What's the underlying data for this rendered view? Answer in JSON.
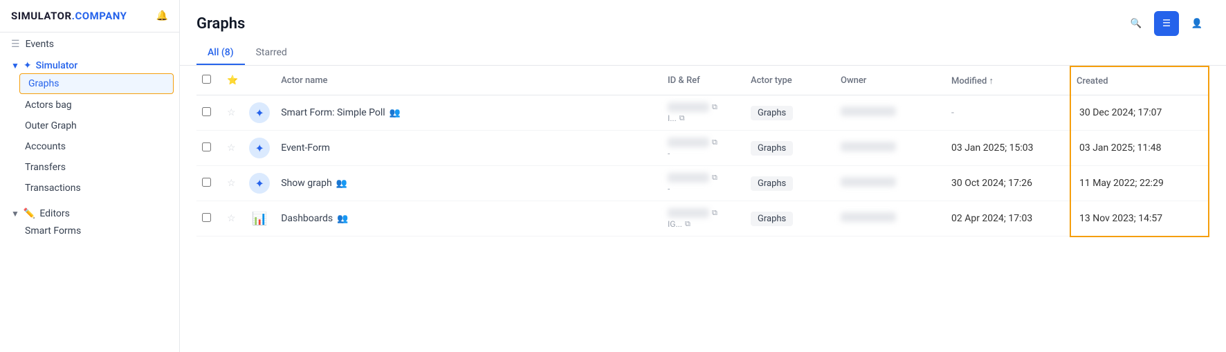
{
  "logo": {
    "prefix": "SIMULATOR",
    "suffix": ".COMPANY"
  },
  "sidebar": {
    "events_label": "Events",
    "simulator_label": "Simulator",
    "graphs_label": "Graphs",
    "actors_bag_label": "Actors bag",
    "outer_graph_label": "Outer Graph",
    "accounts_label": "Accounts",
    "transfers_label": "Transfers",
    "transactions_label": "Transactions",
    "editors_label": "Editors",
    "smart_forms_label": "Smart Forms"
  },
  "page": {
    "title": "Graphs"
  },
  "tabs": [
    {
      "label": "All (8)",
      "active": true
    },
    {
      "label": "Starred",
      "active": false
    }
  ],
  "table": {
    "columns": [
      {
        "label": ""
      },
      {
        "label": ""
      },
      {
        "label": ""
      },
      {
        "label": "Actor name"
      },
      {
        "label": "ID & Ref"
      },
      {
        "label": "Actor type"
      },
      {
        "label": "Owner"
      },
      {
        "label": "Modified ↑"
      },
      {
        "label": "Created"
      }
    ],
    "rows": [
      {
        "name": "Smart Form: Simple Poll",
        "has_people": true,
        "icon_type": "blue-actor",
        "id_blurred": true,
        "id_suffix": "I...",
        "actor_type": "Graphs",
        "owner_blurred": true,
        "modified": "-",
        "created": "30 Dec 2024; 17:07"
      },
      {
        "name": "Event-Form",
        "has_people": false,
        "icon_type": "blue-actor",
        "id_blurred": true,
        "id_suffix": "-",
        "actor_type": "Graphs",
        "owner_blurred": true,
        "modified": "03 Jan 2025; 15:03",
        "created": "03 Jan 2025; 11:48"
      },
      {
        "name": "Show graph",
        "has_people": true,
        "icon_type": "blue-actor",
        "id_blurred": true,
        "id_suffix": "-",
        "actor_type": "Graphs",
        "owner_blurred": true,
        "modified": "30 Oct 2024; 17:26",
        "created": "11 May 2022; 22:29"
      },
      {
        "name": "Dashboards",
        "has_people": true,
        "icon_type": "colorful",
        "id_blurred": true,
        "id_suffix": "IG...",
        "actor_type": "Graphs",
        "owner_blurred": true,
        "modified": "02 Apr 2024; 17:03",
        "created": "13 Nov 2023; 14:57"
      }
    ]
  }
}
